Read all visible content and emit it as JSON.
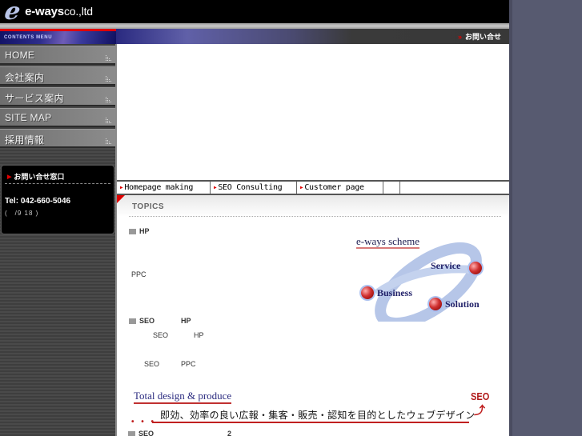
{
  "header": {
    "logo_mark": "e",
    "logo_name": "e-ways",
    "logo_suffix": "co.,ltd",
    "contents_menu_label": "CONTENTS MENU",
    "contact_link": "お問い合せ",
    "contact_arrow_icon": "double-chevron-right"
  },
  "sidebar": {
    "items": [
      {
        "label": "HOME"
      },
      {
        "label": "会社案内"
      },
      {
        "label": "サービス案内"
      },
      {
        "label": "SITE MAP"
      },
      {
        "label": "採用情報"
      }
    ],
    "contact": {
      "title": "お問い合せ窓口",
      "tel": "Tel: 042-660-5046",
      "hours": "(　/9  18 )"
    }
  },
  "tabs": [
    {
      "label": "Homepage making"
    },
    {
      "label": "SEO Consulting"
    },
    {
      "label": "Customer page"
    },
    {
      "label": ""
    }
  ],
  "topics": {
    "title": "TOPICS",
    "items": [
      {
        "heading": "HP"
      },
      {
        "text": "PPC"
      },
      {
        "heading_a": "SEO",
        "heading_b": "HP"
      },
      {
        "text_a": "SEO",
        "text_b": "HP"
      },
      {
        "text_a": "SEO",
        "text_b": "PPC"
      }
    ]
  },
  "scheme": {
    "title": "e-ways scheme",
    "labels": {
      "service": "Service",
      "business": "Business",
      "solution": "Solution"
    }
  },
  "banner": {
    "title": "Total design & produce",
    "seo": "SEO",
    "subtitle": "即効、効率の良い広報・集客・販売・認知を目的としたウェブデザイン",
    "dots": "• • •"
  },
  "bottom": {
    "label_a": "SEO",
    "label_b": "2"
  },
  "colors": {
    "accent_red": "#e00000",
    "nav_blue": "#2c2c8a",
    "scheme_blue": "#23236a",
    "background": "#575a70"
  }
}
